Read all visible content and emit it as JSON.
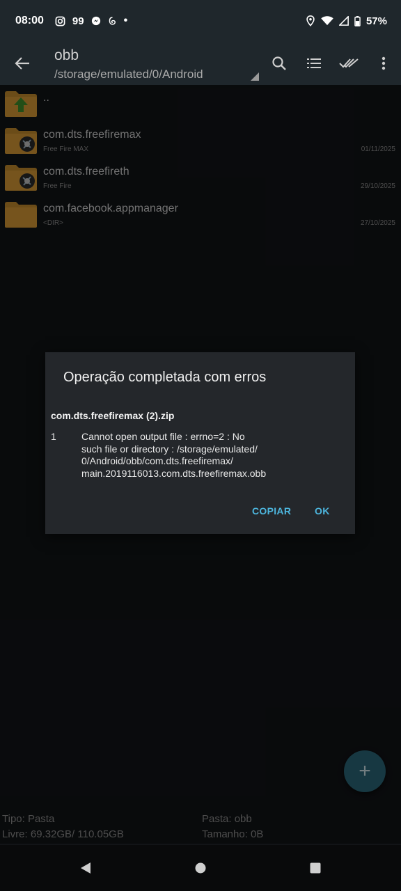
{
  "status_bar": {
    "time": "08:00",
    "left_icons": [
      "instagram-icon",
      "quote-99-icon",
      "messenger-icon",
      "threads-icon",
      "dot-icon"
    ],
    "left_icon_text": {
      "quote": "99",
      "dot": "•"
    },
    "right_icons": [
      "location-icon",
      "wifi-icon",
      "signal-icon",
      "battery-icon"
    ],
    "battery": "57%"
  },
  "toolbar": {
    "title": "obb",
    "path": "/storage/emulated/0/Android",
    "actions": [
      "search-icon",
      "list-view-icon",
      "select-all-icon",
      "more-vert-icon"
    ]
  },
  "files": [
    {
      "name": "..",
      "sub": "",
      "date": "",
      "icon": "folder-up-icon"
    },
    {
      "name": "com.dts.freefiremax",
      "sub": "Free Fire MAX",
      "date": "01/11/2025",
      "icon": "folder-app-icon"
    },
    {
      "name": "com.dts.freefireth",
      "sub": "Free Fire",
      "date": "29/10/2025",
      "icon": "folder-app-icon"
    },
    {
      "name": "com.facebook.appmanager",
      "sub": "<DIR>",
      "date": "27/10/2025",
      "icon": "folder-icon"
    }
  ],
  "dialog": {
    "title": "Operação completada com erros",
    "filename": "com.dts.freefiremax (2).zip",
    "error_number": "1",
    "error_lines": [
      "Cannot open output file : errno=2 : No",
      "such file or directory : /storage/emulated/",
      "0/Android/obb/com.dts.freefiremax/",
      "main.2019116013.com.dts.freefiremax.obb"
    ],
    "copy_label": "COPIAR",
    "ok_label": "OK"
  },
  "fab": {
    "symbol": "+"
  },
  "footer": {
    "type": "Tipo: Pasta",
    "free": "Livre: 69.32GB/ 110.05GB",
    "folder": "Pasta: obb",
    "size": "Tamanho: 0B"
  },
  "colors": {
    "accent": "#4db6de",
    "folder": "#c48a2c",
    "fab": "#2a6678",
    "bar": "#1f272c"
  }
}
